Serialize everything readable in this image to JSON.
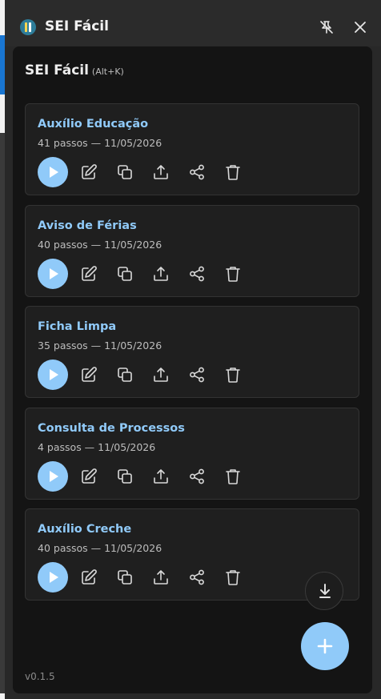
{
  "window": {
    "title": "SEI Fácil"
  },
  "panel": {
    "title": "SEI Fácil",
    "shortcut": "(Alt+K)"
  },
  "cards": [
    {
      "title": "Auxílio Educação",
      "meta": "41 passos — 11/05/2026"
    },
    {
      "title": "Aviso de Férias",
      "meta": "40 passos — 11/05/2026"
    },
    {
      "title": "Ficha Limpa",
      "meta": "35 passos — 11/05/2026"
    },
    {
      "title": "Consulta de Processos",
      "meta": "4 passos — 11/05/2026"
    },
    {
      "title": "Auxílio Creche",
      "meta": "40 passos — 11/05/2026"
    }
  ],
  "card_actions": [
    "play-icon",
    "edit-icon",
    "copy-icon",
    "export-icon",
    "share-icon",
    "trash-icon"
  ],
  "fabs": {
    "download": "download-icon",
    "add": "plus-icon"
  },
  "version": "v0.1.5",
  "colors": {
    "accent": "#90caf9",
    "panel_bg": "#141414",
    "card_bg": "#1f1f1f",
    "titlebar_bg": "#2b2b2b"
  }
}
